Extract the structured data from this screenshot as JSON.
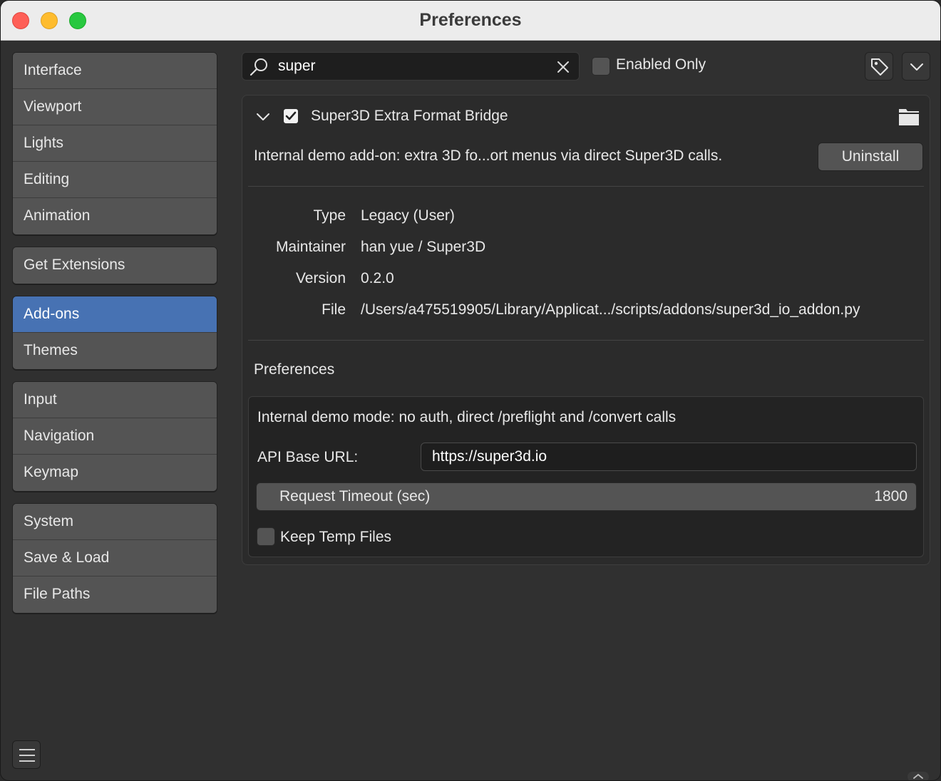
{
  "window": {
    "title": "Preferences"
  },
  "sidebar": {
    "groups": [
      [
        {
          "label": "Interface"
        },
        {
          "label": "Viewport"
        },
        {
          "label": "Lights"
        },
        {
          "label": "Editing"
        },
        {
          "label": "Animation"
        }
      ],
      [
        {
          "label": "Get Extensions"
        }
      ],
      [
        {
          "label": "Add-ons",
          "active": true
        },
        {
          "label": "Themes"
        }
      ],
      [
        {
          "label": "Input"
        },
        {
          "label": "Navigation"
        },
        {
          "label": "Keymap"
        }
      ],
      [
        {
          "label": "System"
        },
        {
          "label": "Save & Load"
        },
        {
          "label": "File Paths"
        }
      ]
    ]
  },
  "toolbar": {
    "search_value": "super",
    "enabled_only_label": "Enabled Only",
    "enabled_only_checked": false
  },
  "addon": {
    "name": "Super3D Extra Format Bridge",
    "enabled": true,
    "expanded": true,
    "description": "Internal demo add-on: extra 3D fo...ort menus via direct Super3D calls.",
    "uninstall_label": "Uninstall",
    "meta": {
      "type_label": "Type",
      "type_value": "Legacy (User)",
      "maintainer_label": "Maintainer",
      "maintainer_value": "han yue / Super3D",
      "version_label": "Version",
      "version_value": "0.2.0",
      "file_label": "File",
      "file_value": "/Users/a475519905/Library/Applicat.../scripts/addons/super3d_io_addon.py"
    },
    "preferences": {
      "title": "Preferences",
      "note": "Internal demo mode: no auth, direct /preflight and /convert calls",
      "api_label": "API Base URL:",
      "api_value": "https://super3d.io",
      "timeout_label": "Request Timeout (sec)",
      "timeout_value": "1800",
      "keep_temp_label": "Keep Temp Files",
      "keep_temp_checked": false
    }
  },
  "colors": {
    "accent": "#4772b3",
    "panel": "#303030",
    "button": "#545454"
  }
}
